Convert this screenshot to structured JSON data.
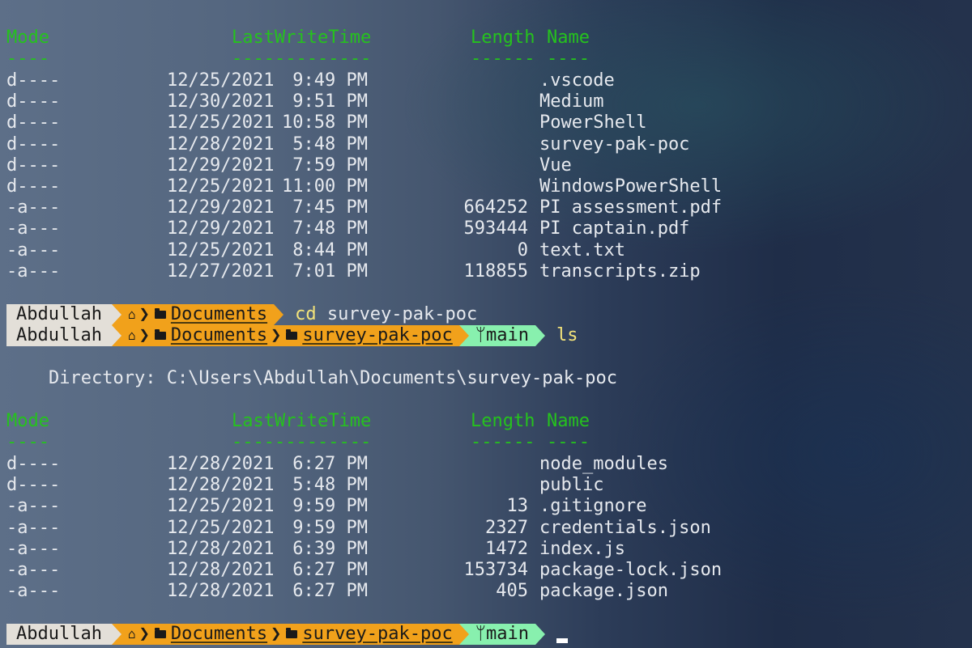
{
  "listing1": {
    "headers": {
      "mode": "Mode",
      "lastwritetime": "LastWriteTime",
      "length": "Length",
      "name": "Name"
    },
    "underlines": {
      "mode": "----",
      "lastwritetime": "-------------",
      "length": "------",
      "name": "----"
    },
    "rows": [
      {
        "mode": "d----",
        "date": "12/25/2021",
        "time": "9:49 PM",
        "length": "",
        "name": ".vscode"
      },
      {
        "mode": "d----",
        "date": "12/30/2021",
        "time": "9:51 PM",
        "length": "",
        "name": "Medium"
      },
      {
        "mode": "d----",
        "date": "12/25/2021",
        "time": "10:58 PM",
        "length": "",
        "name": "PowerShell"
      },
      {
        "mode": "d----",
        "date": "12/28/2021",
        "time": "5:48 PM",
        "length": "",
        "name": "survey-pak-poc"
      },
      {
        "mode": "d----",
        "date": "12/29/2021",
        "time": "7:59 PM",
        "length": "",
        "name": "Vue"
      },
      {
        "mode": "d----",
        "date": "12/25/2021",
        "time": "11:00 PM",
        "length": "",
        "name": "WindowsPowerShell"
      },
      {
        "mode": "-a---",
        "date": "12/29/2021",
        "time": "7:45 PM",
        "length": "664252",
        "name": "PI assessment.pdf"
      },
      {
        "mode": "-a---",
        "date": "12/29/2021",
        "time": "7:48 PM",
        "length": "593444",
        "name": "PI captain.pdf"
      },
      {
        "mode": "-a---",
        "date": "12/25/2021",
        "time": "8:44 PM",
        "length": "0",
        "name": "text.txt"
      },
      {
        "mode": "-a---",
        "date": "12/27/2021",
        "time": "7:01 PM",
        "length": "118855",
        "name": "transcripts.zip"
      }
    ]
  },
  "prompt1": {
    "user": "Abdullah",
    "folder": "Documents",
    "command": "cd",
    "arg": "survey-pak-poc"
  },
  "prompt2": {
    "user": "Abdullah",
    "folder": "Documents",
    "subfolder": "survey-pak-poc",
    "branch": "main",
    "command": "ls"
  },
  "directory_line": "Directory: C:\\Users\\Abdullah\\Documents\\survey-pak-poc",
  "listing2": {
    "headers": {
      "mode": "Mode",
      "lastwritetime": "LastWriteTime",
      "length": "Length",
      "name": "Name"
    },
    "underlines": {
      "mode": "----",
      "lastwritetime": "-------------",
      "length": "------",
      "name": "----"
    },
    "rows": [
      {
        "mode": "d----",
        "date": "12/28/2021",
        "time": "6:27 PM",
        "length": "",
        "name": "node_modules"
      },
      {
        "mode": "d----",
        "date": "12/28/2021",
        "time": "5:48 PM",
        "length": "",
        "name": "public"
      },
      {
        "mode": "-a---",
        "date": "12/25/2021",
        "time": "9:59 PM",
        "length": "13",
        "name": ".gitignore"
      },
      {
        "mode": "-a---",
        "date": "12/25/2021",
        "time": "9:59 PM",
        "length": "2327",
        "name": "credentials.json"
      },
      {
        "mode": "-a---",
        "date": "12/28/2021",
        "time": "6:39 PM",
        "length": "1472",
        "name": "index.js"
      },
      {
        "mode": "-a---",
        "date": "12/28/2021",
        "time": "6:27 PM",
        "length": "153734",
        "name": "package-lock.json"
      },
      {
        "mode": "-a---",
        "date": "12/28/2021",
        "time": "6:27 PM",
        "length": "405",
        "name": "package.json"
      }
    ]
  },
  "prompt3": {
    "user": "Abdullah",
    "folder": "Documents",
    "subfolder": "survey-pak-poc",
    "branch": "main"
  },
  "icons": {
    "home": "home-icon",
    "folder": "folder-icon",
    "branch": "git-branch-icon",
    "separator": "chevron-right-icon"
  },
  "colors": {
    "header": "#25c21d",
    "text": "#e6e9ee",
    "user_segment": "#e3dfd8",
    "folder_segment": "#f1a11b",
    "git_segment": "#88f0ae",
    "command": "#f3e37a"
  }
}
